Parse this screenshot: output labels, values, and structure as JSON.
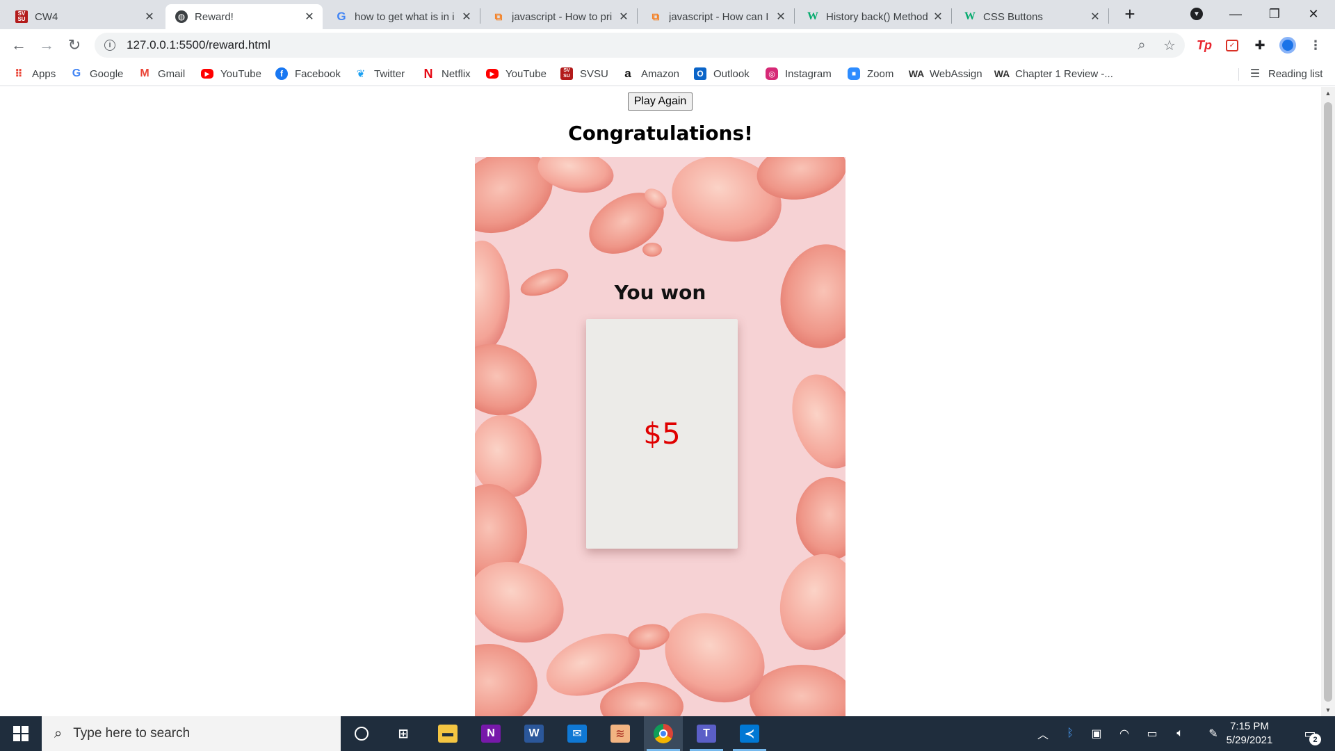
{
  "browser": {
    "tabs": [
      {
        "title": "CW4",
        "icon": "svsu-icon",
        "active": false
      },
      {
        "title": "Reward!",
        "icon": "globe-icon",
        "active": true
      },
      {
        "title": "how to get what is in i",
        "icon": "google-icon",
        "active": false
      },
      {
        "title": "javascript - How to pri",
        "icon": "stackoverflow-icon",
        "active": false
      },
      {
        "title": "javascript - How can I",
        "icon": "stackoverflow-icon",
        "active": false
      },
      {
        "title": "History back() Method",
        "icon": "w3schools-icon",
        "active": false
      },
      {
        "title": "CSS Buttons",
        "icon": "w3schools-icon",
        "active": false
      }
    ],
    "url": "127.0.0.1:5500/reward.html",
    "bookmarks": [
      {
        "label": "Apps",
        "icon": "apps-grid-icon"
      },
      {
        "label": "Google",
        "icon": "google-icon"
      },
      {
        "label": "Gmail",
        "icon": "gmail-icon"
      },
      {
        "label": "YouTube",
        "icon": "youtube-icon"
      },
      {
        "label": "Facebook",
        "icon": "facebook-icon"
      },
      {
        "label": "Twitter",
        "icon": "twitter-icon"
      },
      {
        "label": "Netflix",
        "icon": "netflix-icon"
      },
      {
        "label": "YouTube",
        "icon": "youtube-icon"
      },
      {
        "label": "SVSU",
        "icon": "svsu-icon"
      },
      {
        "label": "Amazon",
        "icon": "amazon-icon"
      },
      {
        "label": "Outlook",
        "icon": "outlook-icon"
      },
      {
        "label": "Instagram",
        "icon": "instagram-icon"
      },
      {
        "label": "Zoom",
        "icon": "zoom-icon"
      },
      {
        "label": "WebAssign",
        "icon": "webassign-icon"
      },
      {
        "label": "Chapter 1 Review -...",
        "icon": "webassign-icon"
      }
    ],
    "reading_list": "Reading list"
  },
  "page": {
    "play_again": "Play Again",
    "heading": "Congratulations!",
    "you_won": "You won",
    "prize": "$5"
  },
  "taskbar": {
    "search_placeholder": "Type here to search",
    "time": "7:15 PM",
    "date": "5/29/2021",
    "notification_count": "2"
  },
  "colors": {
    "prize_text": "#e00000",
    "card_background": "#f6d2d4",
    "taskbar": "#1f2d3d"
  }
}
